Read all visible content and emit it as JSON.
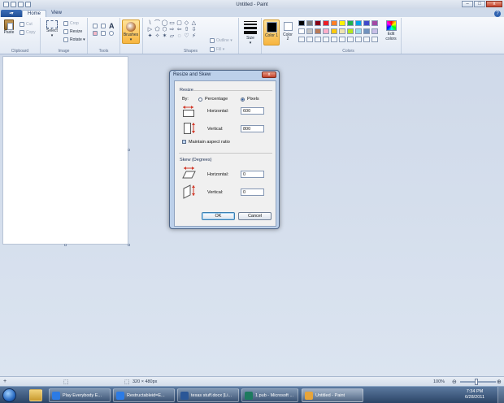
{
  "window": {
    "title": "Untitled - Paint",
    "minimize": "–",
    "maximize": "□",
    "close": "x"
  },
  "ribbon": {
    "file_label": "▪▾",
    "tabs": [
      "Home",
      "View"
    ],
    "help": "?",
    "clipboard": {
      "paste": "Paste",
      "cut": "Cut",
      "copy": "Copy",
      "label": "Clipboard"
    },
    "image": {
      "select": "Select",
      "crop": "Crop",
      "resize": "Resize",
      "rotate": "Rotate ▾",
      "label": "Image"
    },
    "tools": {
      "label": "Tools",
      "text_tool": "A"
    },
    "brushes": {
      "label": "Brushes"
    },
    "shapes": {
      "label": "Shapes",
      "glyphs": [
        "\\",
        "⌒",
        "◯",
        "▭",
        "▢",
        "◇",
        "△",
        "▷",
        "⬠",
        "⬡",
        "⇨",
        "⇦",
        "⇧",
        "⇩",
        "✦",
        "✧",
        "✶",
        "▱",
        "◌",
        "♡",
        "⚡"
      ],
      "outline": "Outline ▾",
      "fill": "Fill ▾"
    },
    "size": {
      "label": "Size"
    },
    "color1": {
      "label": "Color 1"
    },
    "color2": {
      "label": "Color 2"
    },
    "colors": {
      "label": "Colors",
      "row1": [
        "#000000",
        "#7f7f7f",
        "#880015",
        "#ed1c24",
        "#ff7f27",
        "#fff200",
        "#22b14c",
        "#00a2e8",
        "#3f48cc",
        "#a349a4"
      ],
      "row2": [
        "#ffffff",
        "#c3c3c3",
        "#b97a57",
        "#ffaec9",
        "#ffc90e",
        "#efe4b0",
        "#b5e61d",
        "#99d9ea",
        "#7092be",
        "#c8bfe7"
      ],
      "edit": "Edit colors"
    }
  },
  "dialog": {
    "title": "Resize and Skew",
    "close": "x",
    "resize_section": "Resize",
    "by_label": "By:",
    "percentage": "Percentage",
    "pixels": "Pixels",
    "horizontal_label": "Horizontal:",
    "vertical_label": "Vertical:",
    "resize_horizontal": "600",
    "resize_vertical": "800",
    "maintain_aspect": "Maintain aspect ratio",
    "skew_section": "Skew (Degrees)",
    "skew_horizontal": "0",
    "skew_vertical": "0",
    "ok": "OK",
    "cancel": "Cancel"
  },
  "status": {
    "pos": "+",
    "select_icon": "⬚",
    "dimensions": "320 × 480px",
    "zoom": "100%",
    "zoom_out": "⊖",
    "zoom_in": "⊕"
  },
  "taskbar": {
    "items": [
      {
        "label": "Play Everybody E...",
        "color": "#2c7be5"
      },
      {
        "label": "Restructableid=E...",
        "color": "#2c7be5"
      },
      {
        "label": "texas stuff.docx [Li...",
        "color": "#2b5797"
      },
      {
        "label": "1.pub - Microsoft ...",
        "color": "#1d7a5f"
      },
      {
        "label": "Untitled - Paint",
        "color": "#e7a43a"
      }
    ],
    "time": "7:34 PM",
    "date": "6/28/2011"
  }
}
